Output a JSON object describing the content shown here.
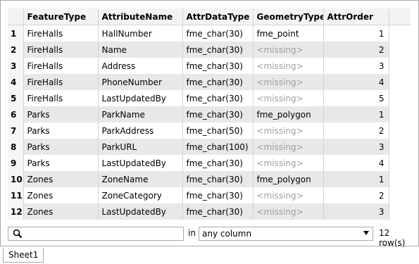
{
  "table": {
    "columns": [
      "FeatureType",
      "AttributeName",
      "AttrDataType",
      "GeometryType",
      "AttrOrder"
    ],
    "rows": [
      {
        "n": "1",
        "feature": "FireHalls",
        "attribute": "HallNumber",
        "dtype": "fme_char(30)",
        "geom": "fme_point",
        "order": "1"
      },
      {
        "n": "2",
        "feature": "FireHalls",
        "attribute": "Name",
        "dtype": "fme_char(30)",
        "geom": "<missing>",
        "order": "2"
      },
      {
        "n": "3",
        "feature": "FireHalls",
        "attribute": "Address",
        "dtype": "fme_char(30)",
        "geom": "<missing>",
        "order": "3"
      },
      {
        "n": "4",
        "feature": "FireHalls",
        "attribute": "PhoneNumber",
        "dtype": "fme_char(30)",
        "geom": "<missing>",
        "order": "4"
      },
      {
        "n": "5",
        "feature": "FireHalls",
        "attribute": "LastUpdatedBy",
        "dtype": "fme_char(30)",
        "geom": "<missing>",
        "order": "5"
      },
      {
        "n": "6",
        "feature": "Parks",
        "attribute": "ParkName",
        "dtype": "fme_char(30)",
        "geom": "fme_polygon",
        "order": "1"
      },
      {
        "n": "7",
        "feature": "Parks",
        "attribute": "ParkAddress",
        "dtype": "fme_char(50)",
        "geom": "<missing>",
        "order": "2"
      },
      {
        "n": "8",
        "feature": "Parks",
        "attribute": "ParkURL",
        "dtype": "fme_char(100)",
        "geom": "<missing>",
        "order": "3"
      },
      {
        "n": "9",
        "feature": "Parks",
        "attribute": "LastUpdatedBy",
        "dtype": "fme_char(30)",
        "geom": "<missing>",
        "order": "4"
      },
      {
        "n": "10",
        "feature": "Zones",
        "attribute": "ZoneName",
        "dtype": "fme_char(30)",
        "geom": "fme_polygon",
        "order": "1"
      },
      {
        "n": "11",
        "feature": "Zones",
        "attribute": "ZoneCategory",
        "dtype": "fme_char(30)",
        "geom": "<missing>",
        "order": "2"
      },
      {
        "n": "12",
        "feature": "Zones",
        "attribute": "LastUpdatedBy",
        "dtype": "fme_char(30)",
        "geom": "<missing>",
        "order": "3"
      }
    ]
  },
  "filter": {
    "search_value": "",
    "in_label": "in",
    "column_selected": "any column",
    "row_count": "12 row(s)"
  },
  "sheet_tab": "Sheet1",
  "icons": {
    "search": "search-icon",
    "dropdown": "chevron-down-icon"
  }
}
